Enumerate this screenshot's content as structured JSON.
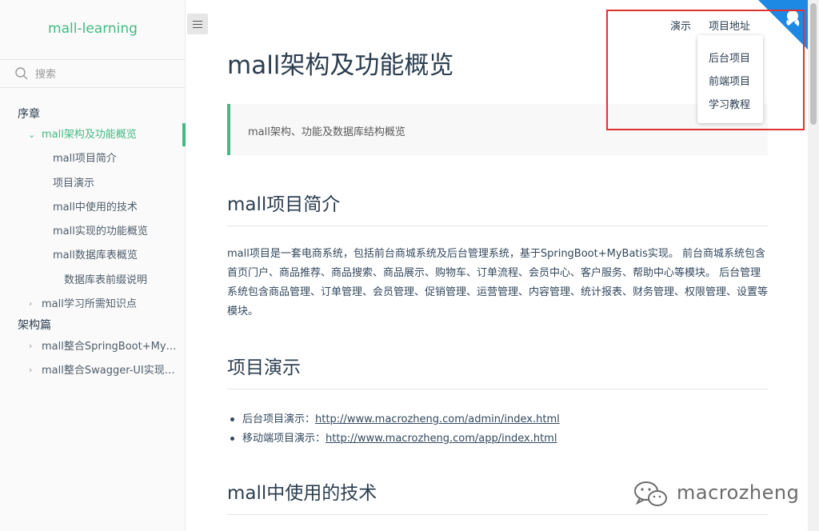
{
  "app_name": "mall-learning",
  "search": {
    "placeholder": "搜索"
  },
  "sidebar": {
    "items": [
      {
        "label": "序章"
      },
      {
        "label": "mall架构及功能概览"
      },
      {
        "label": "mall项目简介"
      },
      {
        "label": "项目演示"
      },
      {
        "label": "mall中使用的技术"
      },
      {
        "label": "mall实现的功能概览"
      },
      {
        "label": "mall数据库表概览"
      },
      {
        "label": "数据库表前缀说明"
      },
      {
        "label": "mall学习所需知识点"
      },
      {
        "label": "架构篇"
      },
      {
        "label": "mall整合SpringBoot+MyBatis搭建基本骨架"
      },
      {
        "label": "mall整合Swagger-UI实现在线API文档"
      }
    ]
  },
  "top_nav": {
    "demo": "演示",
    "project": "项目地址",
    "dropdown": [
      "后台项目",
      "前端项目",
      "学习教程"
    ]
  },
  "main": {
    "title": "mall架构及功能概览",
    "tip": "mall架构、功能及数据库结构概览",
    "h2_intro": "mall项目简介",
    "intro_para": "mall项目是一套电商系统，包括前台商城系统及后台管理系统，基于SpringBoot+MyBatis实现。 前台商城系统包含首页门户、商品推荐、商品搜索、商品展示、购物车、订单流程、会员中心、客户服务、帮助中心等模块。 后台管理系统包含商品管理、订单管理、会员管理、促销管理、运营管理、内容管理、统计报表、财务管理、权限管理、设置等模块。",
    "h2_demo": "项目演示",
    "demo_items": [
      {
        "label": "后台项目演示：",
        "url": "http://www.macrozheng.com/admin/index.html"
      },
      {
        "label": "移动端项目演示：",
        "url": "http://www.macrozheng.com/app/index.html"
      }
    ],
    "h2_tech": "mall中使用的技术"
  },
  "watermark": "macrozheng",
  "colors": {
    "accent": "#42b983",
    "highlight": "#e03131",
    "corner": "#1e88e5"
  }
}
